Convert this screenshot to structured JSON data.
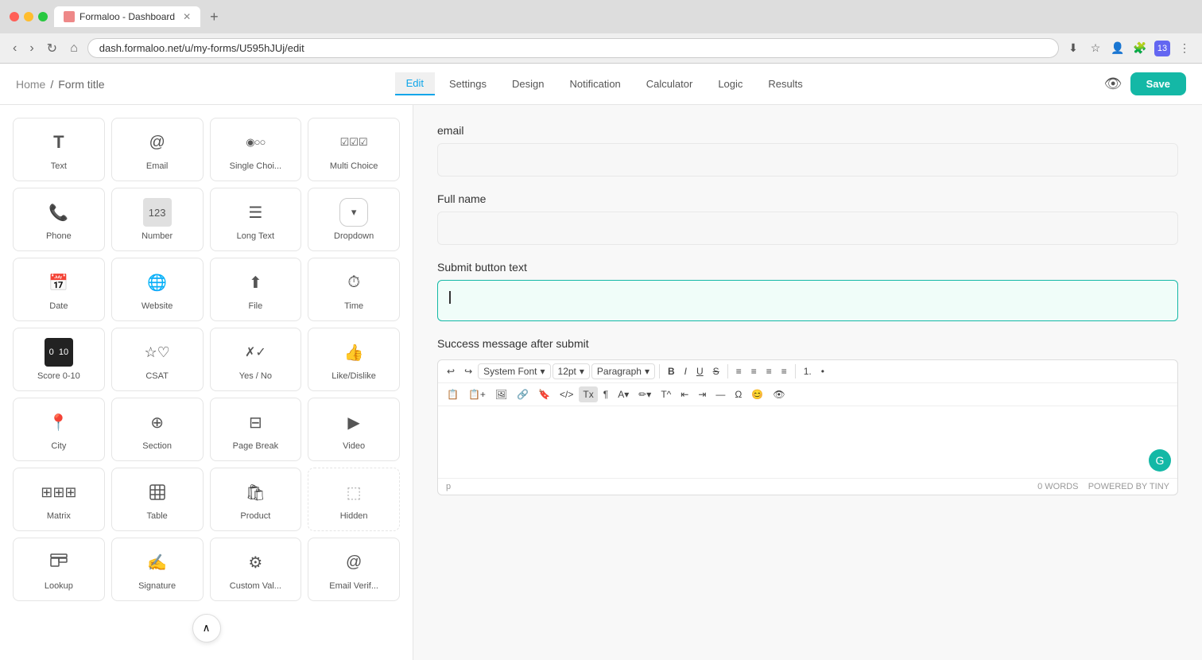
{
  "browser": {
    "tab_title": "Formaloo - Dashboard",
    "url": "dash.formaloo.net/u/my-forms/U595hJUj/edit",
    "new_tab_icon": "+"
  },
  "header": {
    "breadcrumb_home": "Home",
    "breadcrumb_sep": "/",
    "form_title": "Form title",
    "tabs": [
      {
        "id": "edit",
        "label": "Edit",
        "active": true
      },
      {
        "id": "settings",
        "label": "Settings",
        "active": false
      },
      {
        "id": "design",
        "label": "Design",
        "active": false
      },
      {
        "id": "notification",
        "label": "Notification",
        "active": false
      },
      {
        "id": "calculator",
        "label": "Calculator",
        "active": false
      },
      {
        "id": "logic",
        "label": "Logic",
        "active": false
      },
      {
        "id": "results",
        "label": "Results",
        "active": false
      }
    ],
    "save_label": "Save"
  },
  "left_panel": {
    "widgets": [
      {
        "id": "text",
        "label": "Text",
        "icon": "T"
      },
      {
        "id": "email",
        "label": "Email",
        "icon": "@"
      },
      {
        "id": "single-choice",
        "label": "Single Choi...",
        "icon": "◉○○"
      },
      {
        "id": "multi-choice",
        "label": "Multi Choice",
        "icon": "☑☑☑"
      },
      {
        "id": "phone",
        "label": "Phone",
        "icon": "📞"
      },
      {
        "id": "number",
        "label": "Number",
        "icon": "123"
      },
      {
        "id": "long-text",
        "label": "Long Text",
        "icon": "≡"
      },
      {
        "id": "dropdown",
        "label": "Dropdown",
        "icon": "▾"
      },
      {
        "id": "date",
        "label": "Date",
        "icon": "📅"
      },
      {
        "id": "website",
        "label": "Website",
        "icon": "🌐"
      },
      {
        "id": "file",
        "label": "File",
        "icon": "↑"
      },
      {
        "id": "time",
        "label": "Time",
        "icon": "⏱"
      },
      {
        "id": "score",
        "label": "Score 0-10",
        "icon": "0-10"
      },
      {
        "id": "csat",
        "label": "CSAT",
        "icon": "★☆"
      },
      {
        "id": "yes-no",
        "label": "Yes / No",
        "icon": "✗✓"
      },
      {
        "id": "like-dislike",
        "label": "Like/Dislike",
        "icon": "👍"
      },
      {
        "id": "city",
        "label": "City",
        "icon": "📍"
      },
      {
        "id": "section",
        "label": "Section",
        "icon": "⊕"
      },
      {
        "id": "page-break",
        "label": "Page Break",
        "icon": "⊟"
      },
      {
        "id": "video",
        "label": "Video",
        "icon": "▶"
      },
      {
        "id": "matrix",
        "label": "Matrix",
        "icon": "⊞"
      },
      {
        "id": "table",
        "label": "Table",
        "icon": "⊞"
      },
      {
        "id": "product",
        "label": "Product",
        "icon": "🛍"
      },
      {
        "id": "hidden",
        "label": "Hidden",
        "icon": "⬚"
      },
      {
        "id": "lookup",
        "label": "Lookup",
        "icon": "⊞"
      },
      {
        "id": "signature",
        "label": "Signature",
        "icon": "✍"
      },
      {
        "id": "custom-val",
        "label": "Custom Val...",
        "icon": "⚙"
      },
      {
        "id": "email-verif",
        "label": "Email Verif...",
        "icon": "@"
      }
    ]
  },
  "right_panel": {
    "fields": [
      {
        "id": "email",
        "label": "email",
        "type": "text",
        "value": "",
        "selected": false
      },
      {
        "id": "full-name",
        "label": "Full name",
        "type": "text",
        "value": "",
        "selected": false
      },
      {
        "id": "submit-btn",
        "label": "Submit button text",
        "type": "text",
        "value": "",
        "selected": true
      }
    ],
    "success_section": {
      "label": "Success message after submit"
    },
    "rich_editor": {
      "toolbar": {
        "undo": "↩",
        "redo": "↪",
        "font_family": "System Font",
        "font_size": "12pt",
        "paragraph": "Paragraph",
        "bold": "B",
        "italic": "I",
        "underline": "U",
        "strikethrough": "S",
        "align_left": "≡",
        "align_center": "≡",
        "align_right": "≡",
        "align_justify": "≡",
        "list_ordered": "1.",
        "list_unordered": "•"
      },
      "footer": {
        "word_count": "0 WORDS",
        "powered_by": "POWERED BY TINY"
      },
      "cursor_line": "p"
    }
  },
  "scroll_up_label": "∧"
}
